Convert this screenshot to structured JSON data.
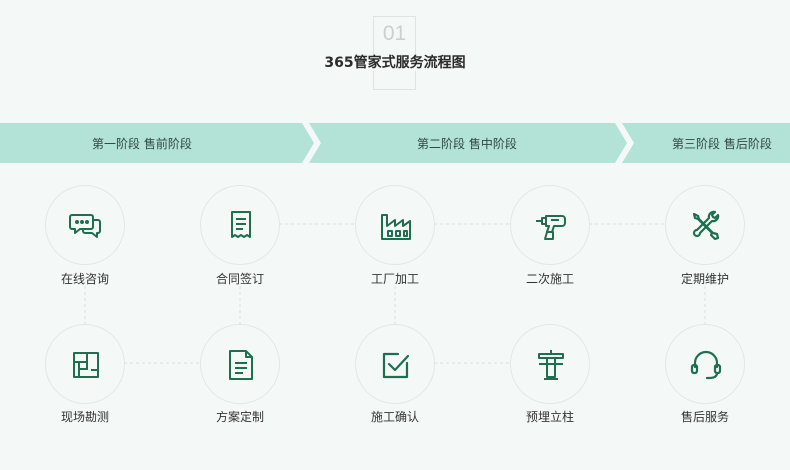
{
  "header": {
    "number": "01",
    "title": "365管家式服务流程图"
  },
  "stages": [
    {
      "label": "第一阶段  售前阶段"
    },
    {
      "label": "第二阶段  售中阶段"
    },
    {
      "label": "第三阶段  售后阶段"
    }
  ],
  "steps": {
    "top": [
      {
        "label": "在线咨询",
        "icon": "chat-bubbles-icon"
      },
      {
        "label": "合同签订",
        "icon": "contract-document-icon"
      },
      {
        "label": "工厂加工",
        "icon": "factory-icon"
      },
      {
        "label": "二次施工",
        "icon": "power-drill-icon"
      },
      {
        "label": "定期维护",
        "icon": "wrench-screwdriver-icon"
      }
    ],
    "bottom": [
      {
        "label": "现场勘测",
        "icon": "floor-plan-icon"
      },
      {
        "label": "方案定制",
        "icon": "plan-document-icon"
      },
      {
        "label": "施工确认",
        "icon": "checkbox-icon"
      },
      {
        "label": "预埋立柱",
        "icon": "pillar-icon"
      },
      {
        "label": "售后服务",
        "icon": "headset-icon"
      }
    ]
  },
  "colors": {
    "accent": "#1f6e4f",
    "band": "#b3e2d6",
    "background": "#f4f9f7",
    "circle_border": "#e3e7e5"
  }
}
